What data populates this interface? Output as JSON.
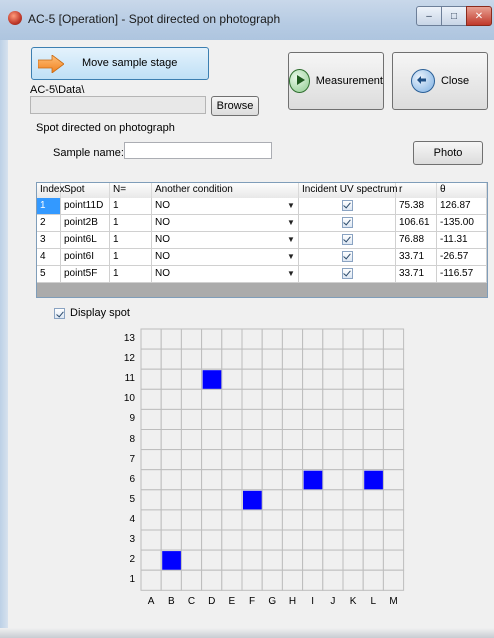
{
  "window": {
    "title": "AC-5 [Operation] - Spot directed on photograph",
    "minimize_glyph": "–",
    "maximize_glyph": "□",
    "close_glyph": "✕"
  },
  "toolbar": {
    "move_label": "Move sample stage",
    "measurement_label": "Measurement",
    "close_label": "Close",
    "browse_label": "Browse",
    "photo_label": "Photo"
  },
  "path": {
    "label": "AC-5\\Data\\",
    "value": ""
  },
  "group": {
    "label": "Spot directed on photograph",
    "sample_name_label": "Sample name:",
    "sample_name_value": ""
  },
  "table": {
    "headers": [
      "Index",
      "Spot",
      "N=",
      "Another condition",
      "Incident UV spectrum",
      "r",
      "θ"
    ],
    "rows": [
      {
        "index": "1",
        "spot": "point11D",
        "n": "1",
        "cond": "NO",
        "uv": true,
        "r": "75.38",
        "theta": "126.87"
      },
      {
        "index": "2",
        "spot": "point2B",
        "n": "1",
        "cond": "NO",
        "uv": true,
        "r": "106.61",
        "theta": "-135.00"
      },
      {
        "index": "3",
        "spot": "point6L",
        "n": "1",
        "cond": "NO",
        "uv": true,
        "r": "76.88",
        "theta": "-11.31"
      },
      {
        "index": "4",
        "spot": "point6I",
        "n": "1",
        "cond": "NO",
        "uv": true,
        "r": "33.71",
        "theta": "-26.57"
      },
      {
        "index": "5",
        "spot": "point5F",
        "n": "1",
        "cond": "NO",
        "uv": true,
        "r": "33.71",
        "theta": "-116.57"
      }
    ]
  },
  "display_spot": {
    "label": "Display spot",
    "checked": true
  },
  "spot_grid": {
    "columns": [
      "A",
      "B",
      "C",
      "D",
      "E",
      "F",
      "G",
      "H",
      "I",
      "J",
      "K",
      "L",
      "M"
    ],
    "rows": [
      13,
      12,
      11,
      10,
      9,
      8,
      7,
      6,
      5,
      4,
      3,
      2,
      1
    ],
    "spots": [
      {
        "col": "D",
        "row": 11
      },
      {
        "col": "B",
        "row": 2
      },
      {
        "col": "L",
        "row": 6
      },
      {
        "col": "I",
        "row": 6
      },
      {
        "col": "F",
        "row": 5
      }
    ],
    "spot_color": "#0000ff"
  }
}
